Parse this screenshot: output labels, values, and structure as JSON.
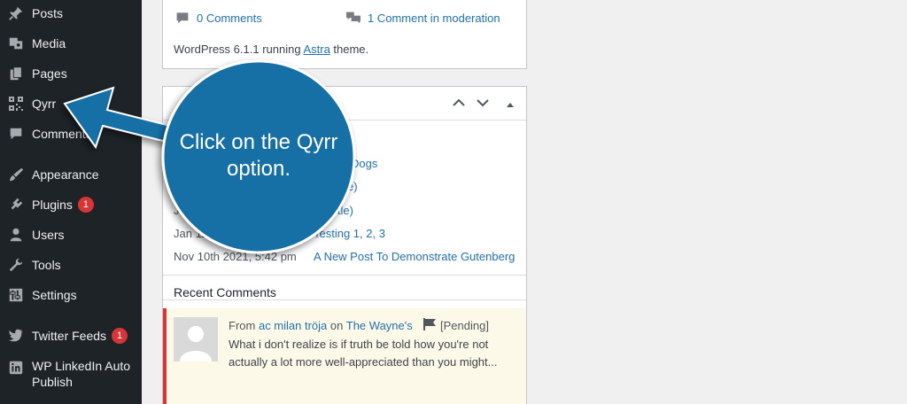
{
  "sidebar": {
    "items": [
      {
        "label": "Posts",
        "icon": "pin-icon",
        "badge": ""
      },
      {
        "label": "Media",
        "icon": "media-icon",
        "badge": ""
      },
      {
        "label": "Pages",
        "icon": "pages-icon",
        "badge": ""
      },
      {
        "label": "Qyrr",
        "icon": "qr-code-icon",
        "badge": ""
      },
      {
        "label": "Comments",
        "icon": "comment-icon",
        "badge": ""
      },
      {
        "label": "Appearance",
        "icon": "brush-icon",
        "badge": ""
      },
      {
        "label": "Plugins",
        "icon": "plug-icon",
        "badge": "1"
      },
      {
        "label": "Users",
        "icon": "user-icon",
        "badge": ""
      },
      {
        "label": "Tools",
        "icon": "wrench-icon",
        "badge": ""
      },
      {
        "label": "Settings",
        "icon": "settings-icon",
        "badge": ""
      },
      {
        "label": "Twitter Feeds",
        "icon": "twitter-icon",
        "badge": "1"
      },
      {
        "label": "WP LinkedIn Auto Publish",
        "icon": "linkedin-icon",
        "badge": ""
      }
    ]
  },
  "at_a_glance": {
    "comments": "0 Comments",
    "moderation": "1 Comment in moderation",
    "wp_line_pre": "WordPress 6.1.1 running ",
    "theme": "Astra",
    "wp_line_post": " theme."
  },
  "activity": {
    "rows": [
      {
        "date": "",
        "title": "Dogs"
      },
      {
        "date": "",
        "title": "e)"
      },
      {
        "date": "Ju",
        "title": "itle)"
      },
      {
        "date": "Jan 11th,",
        "title": "Testing 1, 2, 3"
      },
      {
        "date": "Nov 10th 2021, 5:42 pm",
        "title": "A New Post To Demonstrate Gutenberg"
      }
    ],
    "recent_comments_heading": "Recent Comments",
    "comment": {
      "from": "From",
      "author": "ac milan tröja",
      "on": "on",
      "post": "The Wayne's",
      "status": "[Pending]",
      "text_line1": "What i don't realize is if truth be told how you're not",
      "text_line2": "actually a lot more well-appreciated than you might..."
    }
  },
  "callout": {
    "text_line1": "Click on the Qyrr",
    "text_line2": "option.",
    "color": "#1570a6"
  }
}
